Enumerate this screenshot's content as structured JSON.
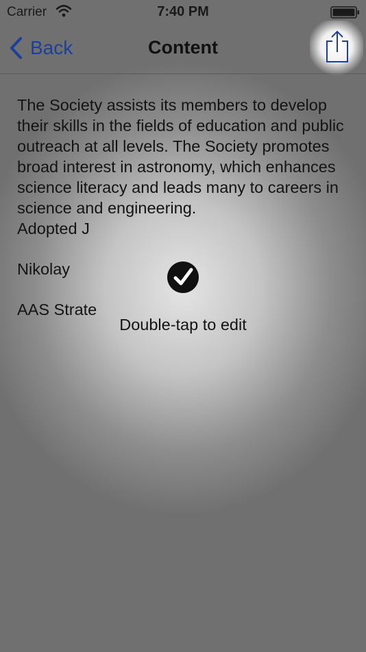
{
  "status_bar": {
    "carrier": "Carrier",
    "time": "7:40 PM",
    "wifi_icon": "wifi-icon",
    "battery_icon": "battery-icon"
  },
  "nav_bar": {
    "back_label": "Back",
    "title": "Content",
    "share_icon": "share-icon",
    "accent_color": "#1c3f9a"
  },
  "content": {
    "paragraph": "The Society assists its members to develop their skills in the fields of education and public outreach at all levels. The Society promotes broad interest in astronomy, which enhances science literacy and leads many to careers in science and engineering.",
    "adopted_line": "Adopted J",
    "author_line": "Nikolay",
    "strategy_line": "AAS Strate"
  },
  "overlay": {
    "hint": "Double-tap to edit",
    "check_icon": "checkmark-circle-icon"
  }
}
